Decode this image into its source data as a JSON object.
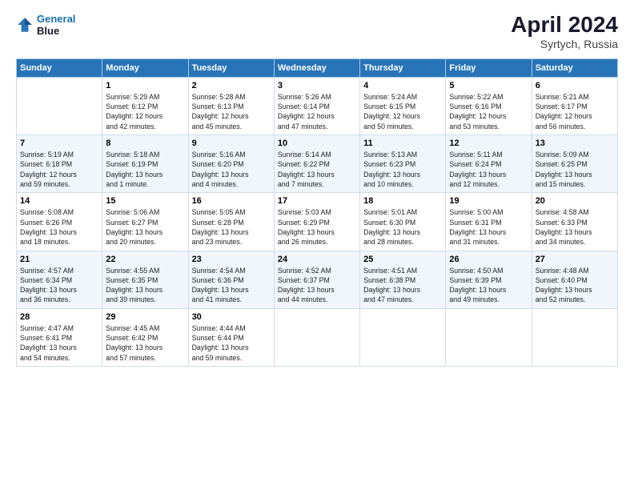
{
  "logo": {
    "text_general": "General",
    "text_blue": "Blue"
  },
  "header": {
    "title": "April 2024",
    "subtitle": "Syrtych, Russia"
  },
  "weekdays": [
    "Sunday",
    "Monday",
    "Tuesday",
    "Wednesday",
    "Thursday",
    "Friday",
    "Saturday"
  ],
  "weeks": [
    [
      {
        "day": "",
        "info": ""
      },
      {
        "day": "1",
        "info": "Sunrise: 5:29 AM\nSunset: 6:12 PM\nDaylight: 12 hours\nand 42 minutes."
      },
      {
        "day": "2",
        "info": "Sunrise: 5:28 AM\nSunset: 6:13 PM\nDaylight: 12 hours\nand 45 minutes."
      },
      {
        "day": "3",
        "info": "Sunrise: 5:26 AM\nSunset: 6:14 PM\nDaylight: 12 hours\nand 47 minutes."
      },
      {
        "day": "4",
        "info": "Sunrise: 5:24 AM\nSunset: 6:15 PM\nDaylight: 12 hours\nand 50 minutes."
      },
      {
        "day": "5",
        "info": "Sunrise: 5:22 AM\nSunset: 6:16 PM\nDaylight: 12 hours\nand 53 minutes."
      },
      {
        "day": "6",
        "info": "Sunrise: 5:21 AM\nSunset: 6:17 PM\nDaylight: 12 hours\nand 56 minutes."
      }
    ],
    [
      {
        "day": "7",
        "info": "Sunrise: 5:19 AM\nSunset: 6:18 PM\nDaylight: 12 hours\nand 59 minutes."
      },
      {
        "day": "8",
        "info": "Sunrise: 5:18 AM\nSunset: 6:19 PM\nDaylight: 13 hours\nand 1 minute."
      },
      {
        "day": "9",
        "info": "Sunrise: 5:16 AM\nSunset: 6:20 PM\nDaylight: 13 hours\nand 4 minutes."
      },
      {
        "day": "10",
        "info": "Sunrise: 5:14 AM\nSunset: 6:22 PM\nDaylight: 13 hours\nand 7 minutes."
      },
      {
        "day": "11",
        "info": "Sunrise: 5:13 AM\nSunset: 6:23 PM\nDaylight: 13 hours\nand 10 minutes."
      },
      {
        "day": "12",
        "info": "Sunrise: 5:11 AM\nSunset: 6:24 PM\nDaylight: 13 hours\nand 12 minutes."
      },
      {
        "day": "13",
        "info": "Sunrise: 5:09 AM\nSunset: 6:25 PM\nDaylight: 13 hours\nand 15 minutes."
      }
    ],
    [
      {
        "day": "14",
        "info": "Sunrise: 5:08 AM\nSunset: 6:26 PM\nDaylight: 13 hours\nand 18 minutes."
      },
      {
        "day": "15",
        "info": "Sunrise: 5:06 AM\nSunset: 6:27 PM\nDaylight: 13 hours\nand 20 minutes."
      },
      {
        "day": "16",
        "info": "Sunrise: 5:05 AM\nSunset: 6:28 PM\nDaylight: 13 hours\nand 23 minutes."
      },
      {
        "day": "17",
        "info": "Sunrise: 5:03 AM\nSunset: 6:29 PM\nDaylight: 13 hours\nand 26 minutes."
      },
      {
        "day": "18",
        "info": "Sunrise: 5:01 AM\nSunset: 6:30 PM\nDaylight: 13 hours\nand 28 minutes."
      },
      {
        "day": "19",
        "info": "Sunrise: 5:00 AM\nSunset: 6:31 PM\nDaylight: 13 hours\nand 31 minutes."
      },
      {
        "day": "20",
        "info": "Sunrise: 4:58 AM\nSunset: 6:33 PM\nDaylight: 13 hours\nand 34 minutes."
      }
    ],
    [
      {
        "day": "21",
        "info": "Sunrise: 4:57 AM\nSunset: 6:34 PM\nDaylight: 13 hours\nand 36 minutes."
      },
      {
        "day": "22",
        "info": "Sunrise: 4:55 AM\nSunset: 6:35 PM\nDaylight: 13 hours\nand 39 minutes."
      },
      {
        "day": "23",
        "info": "Sunrise: 4:54 AM\nSunset: 6:36 PM\nDaylight: 13 hours\nand 41 minutes."
      },
      {
        "day": "24",
        "info": "Sunrise: 4:52 AM\nSunset: 6:37 PM\nDaylight: 13 hours\nand 44 minutes."
      },
      {
        "day": "25",
        "info": "Sunrise: 4:51 AM\nSunset: 6:38 PM\nDaylight: 13 hours\nand 47 minutes."
      },
      {
        "day": "26",
        "info": "Sunrise: 4:50 AM\nSunset: 6:39 PM\nDaylight: 13 hours\nand 49 minutes."
      },
      {
        "day": "27",
        "info": "Sunrise: 4:48 AM\nSunset: 6:40 PM\nDaylight: 13 hours\nand 52 minutes."
      }
    ],
    [
      {
        "day": "28",
        "info": "Sunrise: 4:47 AM\nSunset: 6:41 PM\nDaylight: 13 hours\nand 54 minutes."
      },
      {
        "day": "29",
        "info": "Sunrise: 4:45 AM\nSunset: 6:42 PM\nDaylight: 13 hours\nand 57 minutes."
      },
      {
        "day": "30",
        "info": "Sunrise: 4:44 AM\nSunset: 6:44 PM\nDaylight: 13 hours\nand 59 minutes."
      },
      {
        "day": "",
        "info": ""
      },
      {
        "day": "",
        "info": ""
      },
      {
        "day": "",
        "info": ""
      },
      {
        "day": "",
        "info": ""
      }
    ]
  ]
}
